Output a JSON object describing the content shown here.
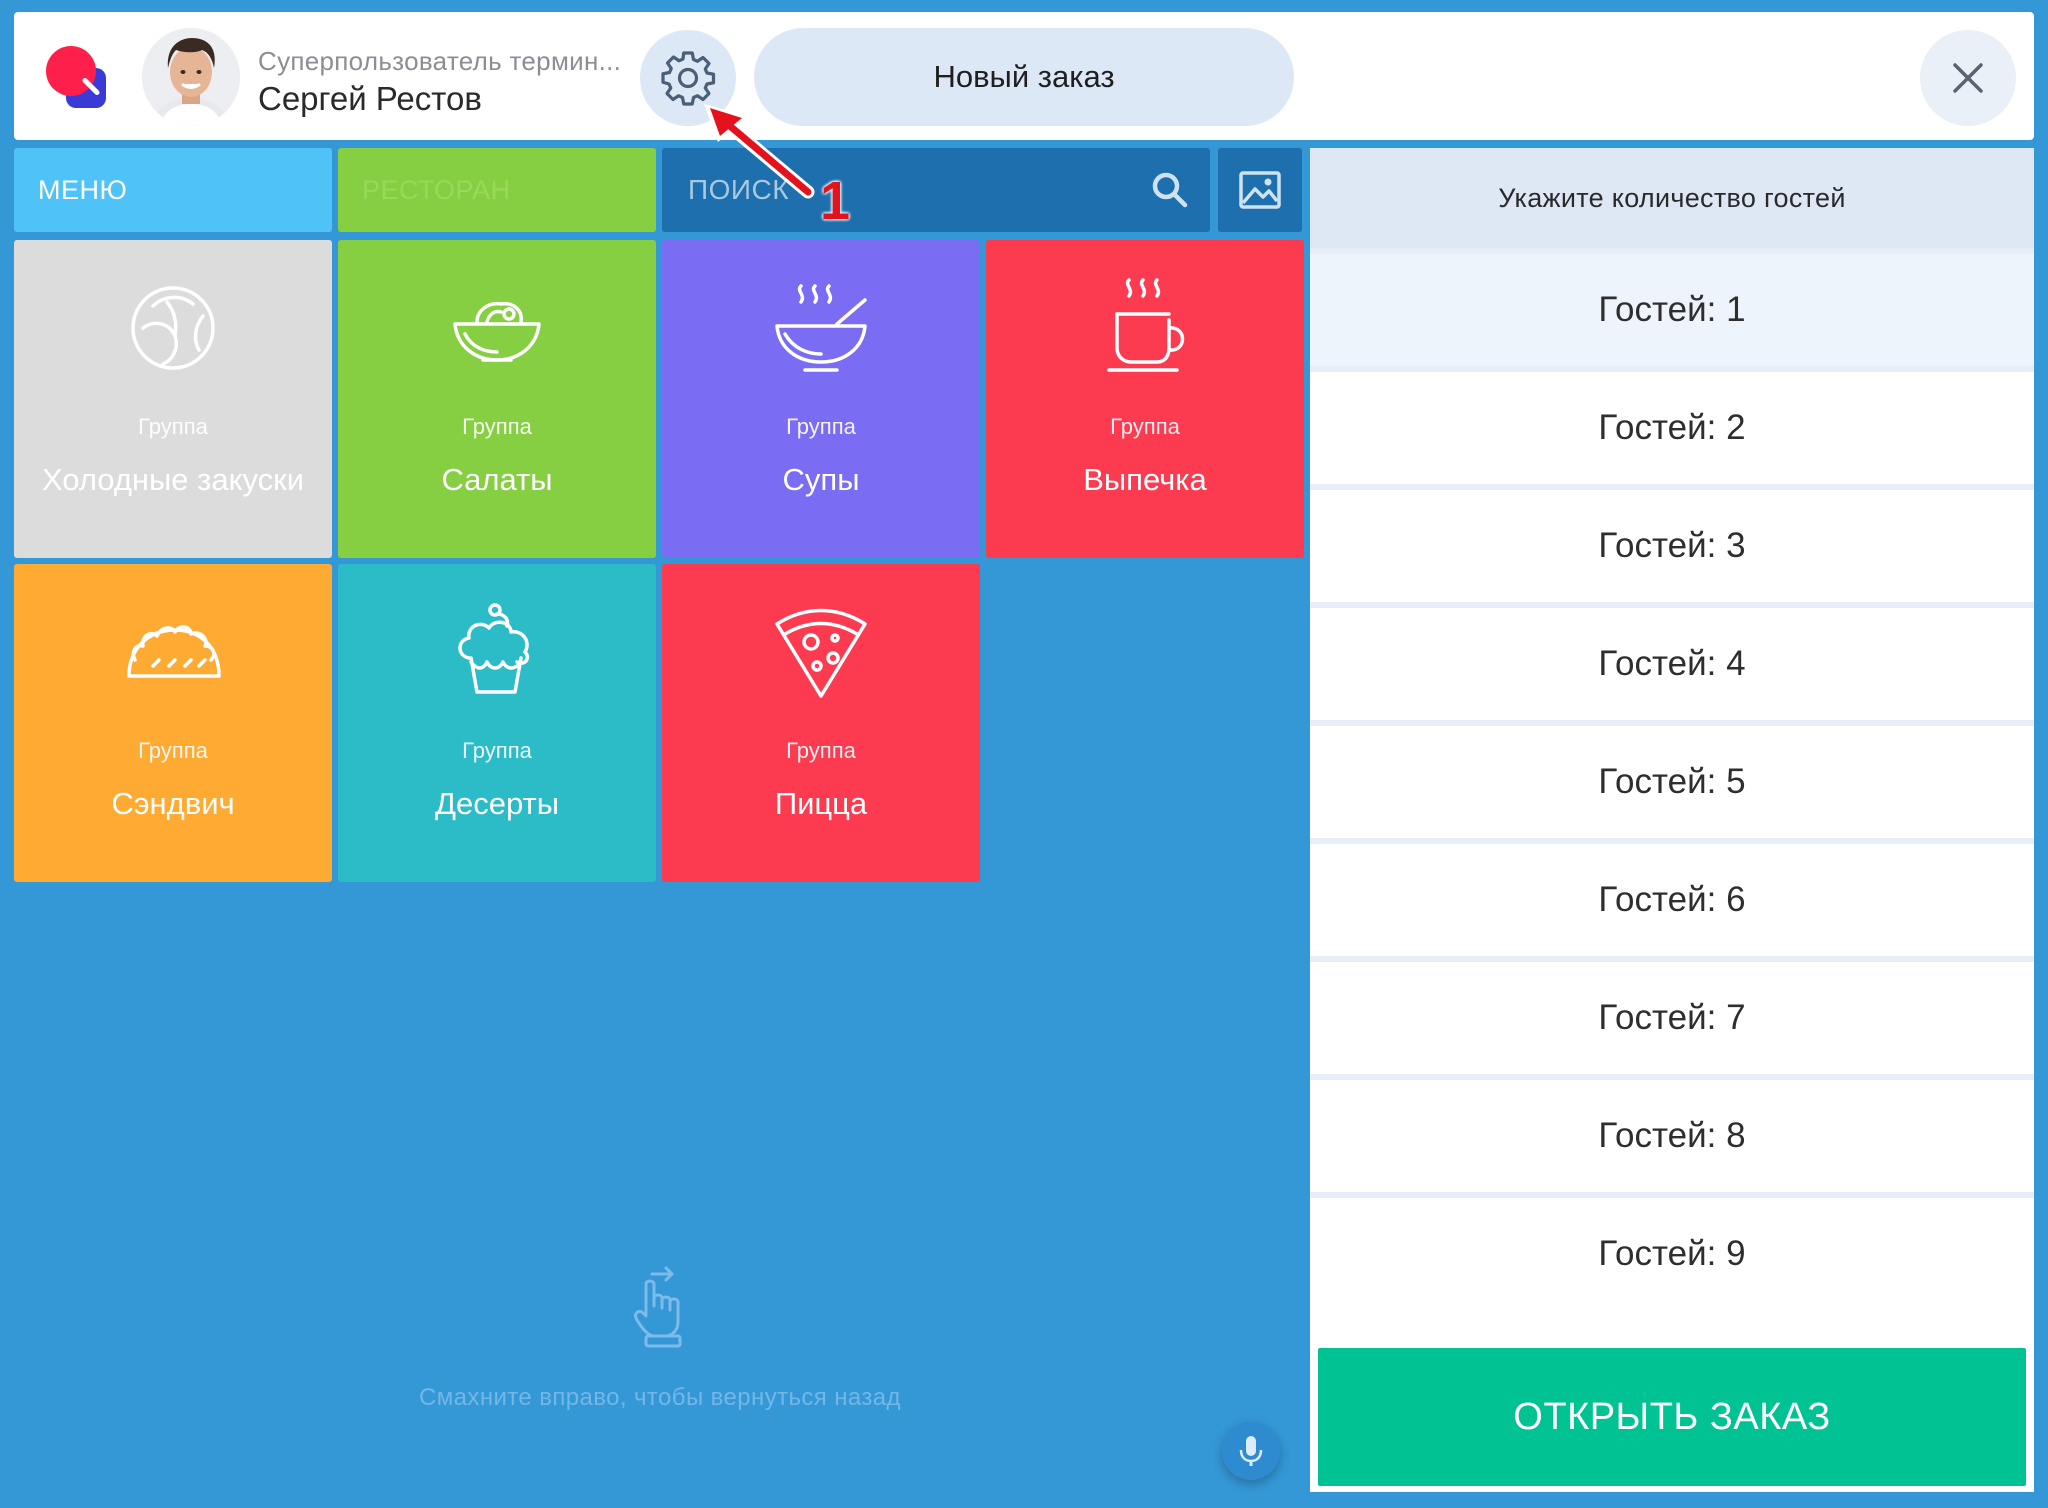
{
  "header": {
    "user_role": "Суперпользователь термин...",
    "user_name": "Сергей Рестов",
    "new_order_label": "Новый заказ"
  },
  "tabs": {
    "menu": "МЕНЮ",
    "restaurant": "РЕСТОРАН"
  },
  "search": {
    "label": "ПОИСК"
  },
  "tiles": [
    {
      "group": "Группа",
      "name": "Холодные закуски",
      "icon": "cabbage-icon",
      "color": "#dcdcdc"
    },
    {
      "group": "Группа",
      "name": "Салаты",
      "icon": "salad-bowl-icon",
      "color": "#86cf42"
    },
    {
      "group": "Группа",
      "name": "Супы",
      "icon": "soup-bowl-icon",
      "color": "#7a6cf3"
    },
    {
      "group": "Группа",
      "name": "Выпечка",
      "icon": "hot-cup-icon",
      "color": "#fc3a50"
    },
    {
      "group": "Группа",
      "name": "Сэндвич",
      "icon": "taco-icon",
      "color": "#ffaa33"
    },
    {
      "group": "Группа",
      "name": "Десерты",
      "icon": "cupcake-icon",
      "color": "#2cbcc7"
    },
    {
      "group": "Группа",
      "name": "Пицца",
      "icon": "pizza-slice-icon",
      "color": "#fc3a50"
    }
  ],
  "swipe_hint": "Смахните вправо, чтобы вернуться назад",
  "guests": {
    "title": "Укажите количество гостей",
    "options": [
      "Гостей: 1",
      "Гостей: 2",
      "Гостей: 3",
      "Гостей: 4",
      "Гостей: 5",
      "Гостей: 6",
      "Гостей: 7",
      "Гостей: 8",
      "Гостей: 9"
    ],
    "selected": "Гостей: 1"
  },
  "open_order_label": "ОТКРЫТЬ ЗАКАЗ",
  "annotation": {
    "number": "1"
  },
  "colors": {
    "background": "#3497d6",
    "accent_green": "#00c292",
    "callout_red": "#e3121c"
  }
}
